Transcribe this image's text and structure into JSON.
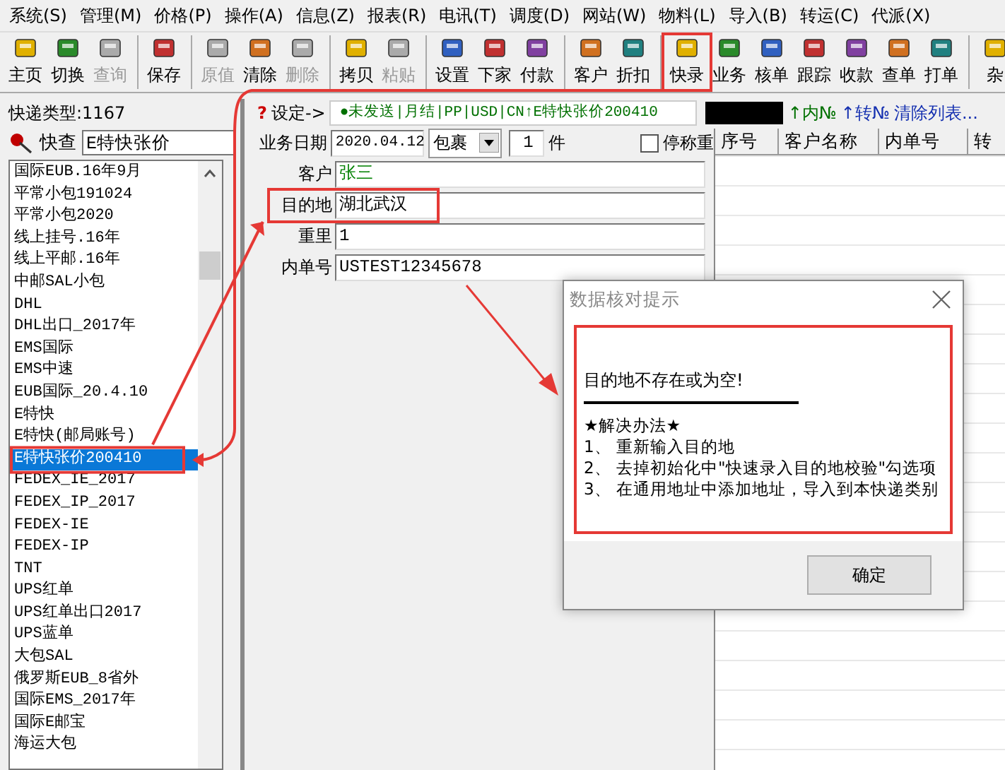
{
  "menu": [
    "系统(S)",
    "管理(M)",
    "价格(P)",
    "操作(A)",
    "信息(Z)",
    "报表(R)",
    "电讯(T)",
    "调度(D)",
    "网站(W)",
    "物料(L)",
    "导入(B)",
    "转运(C)",
    "代派(X)"
  ],
  "toolbar_groups": [
    [
      {
        "label": "主页",
        "disabled": false
      },
      {
        "label": "切换",
        "disabled": false
      },
      {
        "label": "查询",
        "disabled": true
      }
    ],
    [
      {
        "label": "保存",
        "disabled": false
      }
    ],
    [
      {
        "label": "原值",
        "disabled": true
      },
      {
        "label": "清除",
        "disabled": false
      },
      {
        "label": "删除",
        "disabled": true
      }
    ],
    [
      {
        "label": "拷贝",
        "disabled": false
      },
      {
        "label": "粘贴",
        "disabled": true
      }
    ],
    [
      {
        "label": "设置",
        "disabled": false
      },
      {
        "label": "下家",
        "disabled": false
      },
      {
        "label": "付款",
        "disabled": false
      }
    ],
    [
      {
        "label": "客户",
        "disabled": false
      },
      {
        "label": "折扣",
        "disabled": false
      }
    ],
    [
      {
        "label": "快录",
        "disabled": false
      },
      {
        "label": "业务",
        "disabled": false
      },
      {
        "label": "核单",
        "disabled": false
      },
      {
        "label": "跟踪",
        "disabled": false
      },
      {
        "label": "收款",
        "disabled": false
      },
      {
        "label": "查单",
        "disabled": false
      },
      {
        "label": "打单",
        "disabled": false
      }
    ],
    [
      {
        "label": "杂",
        "disabled": false
      }
    ]
  ],
  "express_type": "快递类型:1167",
  "quick_search": {
    "label": "快查",
    "value": "E特快张价"
  },
  "type_list": [
    {
      "label": "国际EUB.16年9月",
      "selected": false
    },
    {
      "label": "平常小包191024",
      "selected": false
    },
    {
      "label": "平常小包2020",
      "selected": false
    },
    {
      "label": "线上挂号.16年",
      "selected": false
    },
    {
      "label": "线上平邮.16年",
      "selected": false
    },
    {
      "label": "中邮SAL小包",
      "selected": false
    },
    {
      "label": "DHL",
      "selected": false
    },
    {
      "label": "DHL出口_2017年",
      "selected": false
    },
    {
      "label": "EMS国际",
      "selected": false
    },
    {
      "label": "EMS中速",
      "selected": false
    },
    {
      "label": "EUB国际_20.4.10",
      "selected": false
    },
    {
      "label": "E特快",
      "selected": false
    },
    {
      "label": "E特快(邮局账号)",
      "selected": false
    },
    {
      "label": "E特快张价200410",
      "selected": true
    },
    {
      "label": "FEDEX_IE_2017",
      "selected": false
    },
    {
      "label": "FEDEX_IP_2017",
      "selected": false
    },
    {
      "label": "FEDEX-IE",
      "selected": false
    },
    {
      "label": "FEDEX-IP",
      "selected": false
    },
    {
      "label": "TNT",
      "selected": false
    },
    {
      "label": "UPS红单",
      "selected": false
    },
    {
      "label": "UPS红单出口2017",
      "selected": false
    },
    {
      "label": "UPS蓝单",
      "selected": false
    },
    {
      "label": "大包SAL",
      "selected": false
    },
    {
      "label": "俄罗斯EUB_8省外",
      "selected": false
    },
    {
      "label": "国际EMS_2017年",
      "selected": false
    },
    {
      "label": "国际E邮宝",
      "selected": false
    },
    {
      "label": "海运大包",
      "selected": false
    }
  ],
  "status_row": {
    "prefix": "?",
    "label": "设定->",
    "status": "●未发送|月结|PP|USD|CN↑E特快张价200410",
    "inner_no": "↑内№",
    "transfer_no": "↑转№",
    "clear": "清除列表..."
  },
  "date_row": {
    "label": "业务日期",
    "date": "2020.04.12",
    "package": "包裹",
    "count": "1",
    "unit": "件",
    "stop_weigh": {
      "label": "停称重",
      "checked": false
    }
  },
  "fields": [
    {
      "label": "客户",
      "value": "张三",
      "color": "#008000"
    },
    {
      "label": "目的地",
      "value": "湖北武汉",
      "color": "#000000"
    },
    {
      "label": "重里",
      "value": "1",
      "color": "#000000"
    },
    {
      "label": "内单号",
      "value": "USTEST12345678",
      "color": "#000000"
    }
  ],
  "grid": {
    "columns": [
      "序号",
      "客户名称",
      "内单号",
      "转"
    ]
  },
  "dialog": {
    "title": "数据核对提示",
    "message": "目的地不存在或为空!",
    "heading": "★解决办法★",
    "steps": [
      "1、 重新输入目的地",
      "2、 去掉初始化中\"快速录入目的地校验\"勾选项",
      "3、 在通用地址中添加地址，导入到本快递类别"
    ],
    "button": "确定"
  }
}
